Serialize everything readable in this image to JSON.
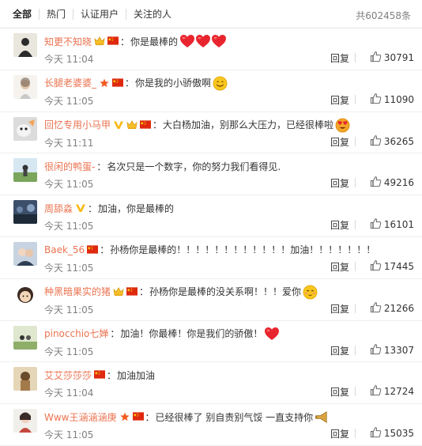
{
  "tabs": [
    {
      "label": "全部"
    },
    {
      "label": "热门"
    },
    {
      "label": "认证用户"
    },
    {
      "label": "关注的人"
    }
  ],
  "total": "共602458条",
  "colors": {
    "username": "#eb7350",
    "meta": "#808080",
    "heart": "#e8252e",
    "smile": "#f8c71f"
  },
  "comments": [
    {
      "user": "知更不知晓",
      "badges": [
        "vip-crown-icon",
        "china-flag-icon"
      ],
      "text": "你是最棒的",
      "emojis": [
        "heart-emoji",
        "heart-emoji",
        "heart-emoji"
      ],
      "time": "今天 11:04",
      "reply": "回复",
      "likes": "30791"
    },
    {
      "user": "长腿老婆婆_",
      "badges": [
        "star-badge-icon",
        "china-flag-icon"
      ],
      "text": "你是我的小骄傲啊",
      "emojis": [
        "smile-emoji"
      ],
      "time": "今天 11:05",
      "reply": "回复",
      "likes": "11090"
    },
    {
      "user": "回忆专用小马甲",
      "badges": [
        "verified-v-icon",
        "vip-crown-icon",
        "china-flag-icon"
      ],
      "text": "大白杨加油，别那么大压力，已经很棒啦",
      "emojis": [
        "heart-eyes-emoji"
      ],
      "time": "今天 11:11",
      "reply": "回复",
      "likes": "36265"
    },
    {
      "user": "很闲的鸭蛋-",
      "badges": [],
      "text": "名次只是一个数字，你的努力我们看得见.",
      "emojis": [],
      "time": "今天 11:05",
      "reply": "回复",
      "likes": "49216"
    },
    {
      "user": "周舔淼",
      "badges": [
        "verified-v-icon"
      ],
      "text": "加油，你是最棒的",
      "emojis": [],
      "time": "今天 11:05",
      "reply": "回复",
      "likes": "16101"
    },
    {
      "user": "Baek_56",
      "badges": [
        "china-flag-icon"
      ],
      "text": "孙杨你是最棒的！！！！！！！！！！！！加油！！！！！！！",
      "emojis": [],
      "time": "今天 11:05",
      "reply": "回复",
      "likes": "17445"
    },
    {
      "user": "种黑暗果实的猪",
      "badges": [
        "vip-crown-icon",
        "china-flag-icon"
      ],
      "text": "孙杨你是最棒的没关系啊！！！爱你",
      "emojis": [
        "blush-emoji"
      ],
      "time": "今天 11:05",
      "reply": "回复",
      "likes": "21266"
    },
    {
      "user": "pinocchio七婵",
      "badges": [],
      "text": "加油！你最棒！你是我们的骄傲！",
      "emojis": [
        "heart-emoji"
      ],
      "time": "今天 11:05",
      "reply": "回复",
      "likes": "13307"
    },
    {
      "user": "艾艾莎莎莎",
      "badges": [
        "china-flag-icon"
      ],
      "text": "加油加油",
      "emojis": [],
      "time": "今天 11:04",
      "reply": "回复",
      "likes": "12724"
    },
    {
      "user": "Www王涵涵涵庚",
      "badges": [
        "star-badge-icon",
        "china-flag-icon"
      ],
      "text": "已经很棒了 别自责别气馁 一直支持你",
      "emojis": [
        "trumpet-emoji"
      ],
      "time": "今天 11:05",
      "reply": "回复",
      "likes": "15035"
    }
  ]
}
